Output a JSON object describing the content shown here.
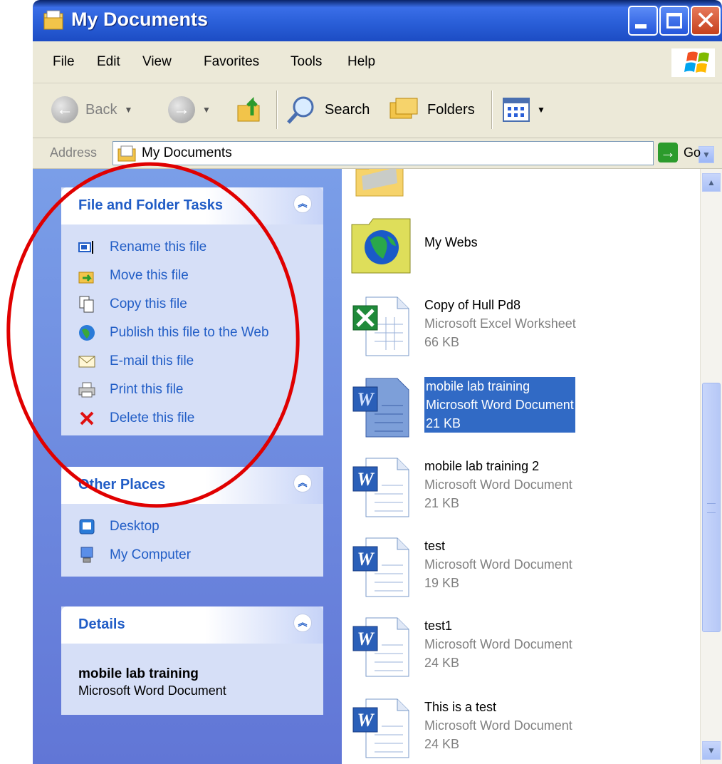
{
  "window": {
    "title": "My Documents"
  },
  "menubar": {
    "items": [
      {
        "label": "File"
      },
      {
        "label": "Edit"
      },
      {
        "label": "View"
      },
      {
        "label": "Favorites"
      },
      {
        "label": "Tools"
      },
      {
        "label": "Help"
      }
    ]
  },
  "toolbar": {
    "back_label": "Back",
    "search_label": "Search",
    "folders_label": "Folders"
  },
  "address": {
    "label": "Address",
    "value": "My Documents",
    "go_label": "Go"
  },
  "left_pane": {
    "file_tasks": {
      "title": "File and Folder Tasks",
      "items": [
        {
          "label": "Rename this file",
          "icon": "rename-icon"
        },
        {
          "label": "Move this file",
          "icon": "move-icon"
        },
        {
          "label": "Copy this file",
          "icon": "copy-icon"
        },
        {
          "label": "Publish this file to the Web",
          "icon": "globe-icon"
        },
        {
          "label": "E-mail this file",
          "icon": "email-icon"
        },
        {
          "label": "Print this file",
          "icon": "printer-icon"
        },
        {
          "label": "Delete this file",
          "icon": "delete-icon"
        }
      ]
    },
    "other_places": {
      "title": "Other Places",
      "items": [
        {
          "label": "Desktop",
          "icon": "desktop-icon"
        },
        {
          "label": "My Computer",
          "icon": "computer-icon"
        }
      ]
    },
    "details": {
      "title": "Details",
      "name": "mobile lab training",
      "type": "Microsoft Word Document"
    }
  },
  "files": [
    {
      "name": "My Webs",
      "type": "",
      "size": "",
      "icon": "web-folder-icon",
      "selected": false
    },
    {
      "name": "Copy of Hull Pd8",
      "type": "Microsoft Excel Worksheet",
      "size": "66 KB",
      "icon": "excel-icon",
      "selected": false
    },
    {
      "name": "mobile lab training",
      "type": "Microsoft Word Document",
      "size": "21 KB",
      "icon": "word-icon",
      "selected": true
    },
    {
      "name": "mobile lab training 2",
      "type": "Microsoft Word Document",
      "size": "21 KB",
      "icon": "word-icon",
      "selected": false
    },
    {
      "name": "test",
      "type": "Microsoft Word Document",
      "size": "19 KB",
      "icon": "word-icon",
      "selected": false
    },
    {
      "name": "test1",
      "type": "Microsoft Word Document",
      "size": "24 KB",
      "icon": "word-icon",
      "selected": false
    },
    {
      "name": "This is a test",
      "type": "Microsoft Word Document",
      "size": "24 KB",
      "icon": "word-icon",
      "selected": false
    }
  ],
  "colors": {
    "selection": "#316ac5",
    "task_link": "#215dc6",
    "annotation": "#e00000"
  }
}
